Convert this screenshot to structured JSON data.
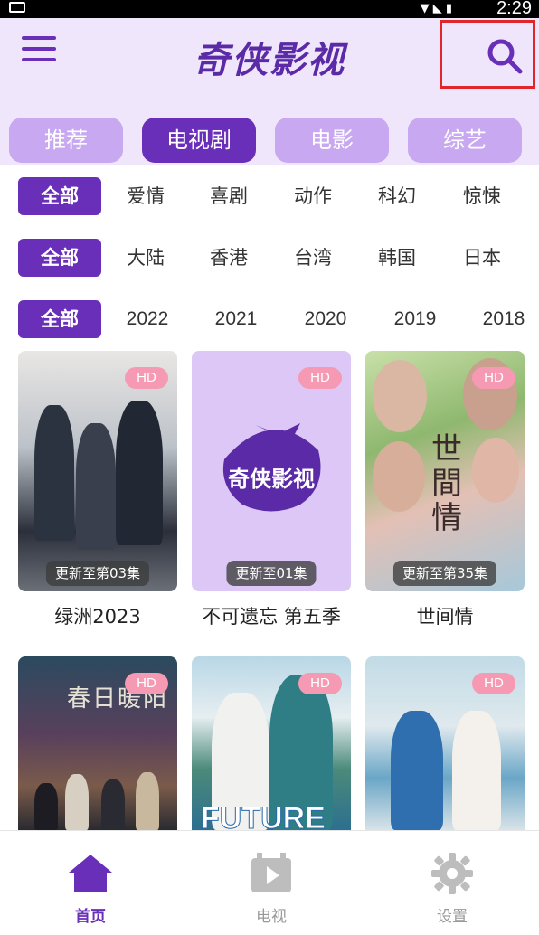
{
  "status": {
    "time": "2:29"
  },
  "header": {
    "title": "奇侠影视"
  },
  "category_tabs": [
    {
      "label": "推荐",
      "active": false
    },
    {
      "label": "电视剧",
      "active": true
    },
    {
      "label": "电影",
      "active": false
    },
    {
      "label": "综艺",
      "active": false
    }
  ],
  "filters": {
    "genre": [
      "全部",
      "爱情",
      "喜剧",
      "动作",
      "科幻",
      "惊悚"
    ],
    "region": [
      "全部",
      "大陆",
      "香港",
      "台湾",
      "韩国",
      "日本"
    ],
    "year": [
      "全部",
      "2022",
      "2021",
      "2020",
      "2019",
      "2018"
    ]
  },
  "cards": [
    {
      "title": "绿洲2023",
      "quality": "HD",
      "episode": "更新至第03集"
    },
    {
      "title": "不可遗忘 第五季",
      "quality": "HD",
      "episode": "更新至01集",
      "poster_text": "奇侠影视"
    },
    {
      "title": "世间情",
      "quality": "HD",
      "episode": "更新至第35集",
      "poster_text": "世間情"
    },
    {
      "title": "",
      "quality": "HD",
      "poster_text": "春日暖阳"
    },
    {
      "title": "",
      "quality": "HD",
      "poster_text": "FUTURE"
    },
    {
      "title": "",
      "quality": "HD"
    }
  ],
  "bottom_nav": [
    {
      "label": "首页",
      "icon": "home-icon",
      "active": true
    },
    {
      "label": "电视",
      "icon": "tv-play-icon",
      "active": false
    },
    {
      "label": "设置",
      "icon": "gear-icon",
      "active": false
    }
  ],
  "colors": {
    "accent": "#6a2fb8",
    "accent_light": "#c8a8f0",
    "header_bg": "#efe6fb",
    "badge": "#f59ab2"
  }
}
